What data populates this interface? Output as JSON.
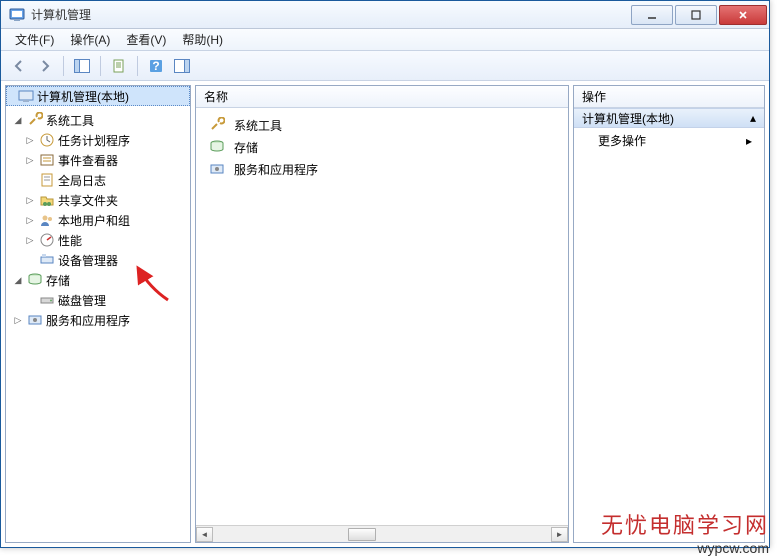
{
  "title": "计算机管理",
  "menu": {
    "file": "文件(F)",
    "action": "操作(A)",
    "view": "查看(V)",
    "help": "帮助(H)"
  },
  "headers": {
    "tree_root": "计算机管理(本地)",
    "name_col": "名称",
    "actions_col": "操作"
  },
  "tree": {
    "system_tools": "系统工具",
    "task_scheduler": "任务计划程序",
    "event_viewer": "事件查看器",
    "global_log": "全局日志",
    "shared_folders": "共享文件夹",
    "local_users": "本地用户和组",
    "performance": "性能",
    "device_manager": "设备管理器",
    "storage": "存储",
    "disk_management": "磁盘管理",
    "services_apps": "服务和应用程序"
  },
  "list": {
    "system_tools": "系统工具",
    "storage": "存储",
    "services_apps": "服务和应用程序"
  },
  "actions": {
    "header": "计算机管理(本地)",
    "more": "更多操作"
  },
  "watermark": {
    "line1": "无忧电脑学习网",
    "line2": "wypcw.com"
  }
}
